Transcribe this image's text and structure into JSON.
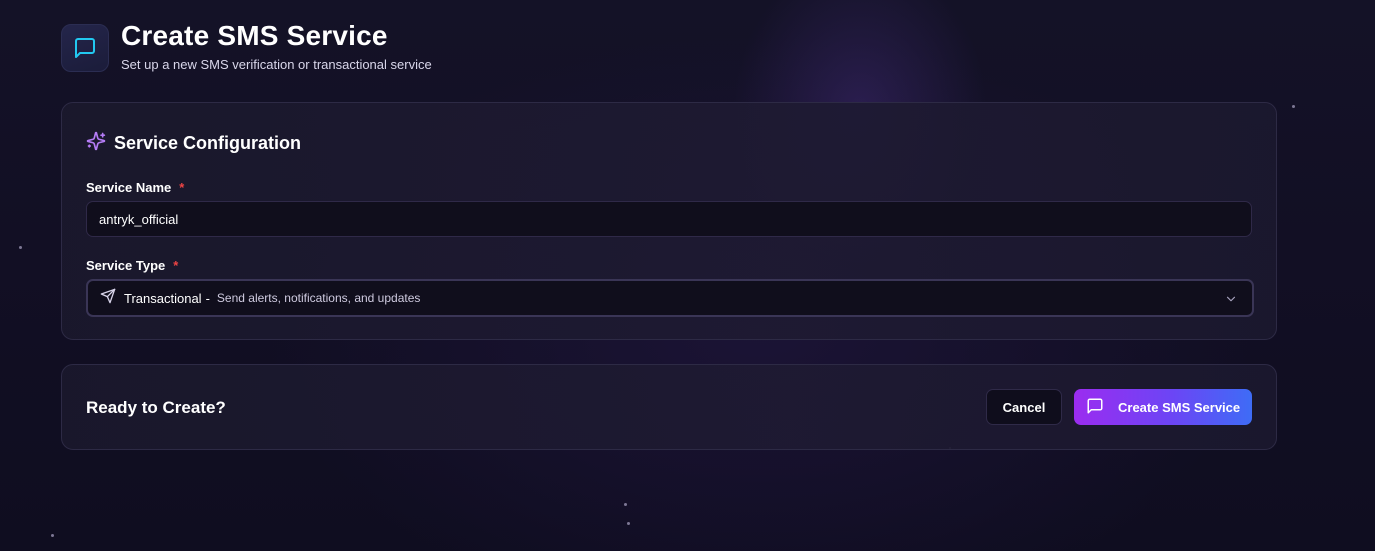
{
  "header": {
    "title": "Create SMS Service",
    "subtitle": "Set up a new SMS verification or transactional service",
    "icon": "message-square-icon"
  },
  "config": {
    "section_title": "Service Configuration",
    "section_icon": "sparkles-icon",
    "service_name": {
      "label": "Service Name",
      "required_marker": "*",
      "value": "antryk_official"
    },
    "service_type": {
      "label": "Service Type",
      "required_marker": "*",
      "icon": "send-icon",
      "selected": "Transactional",
      "separator": "-",
      "description": "Send alerts, notifications, and updates"
    }
  },
  "ready": {
    "title": "Ready to Create?",
    "cancel_label": "Cancel",
    "create_label": "Create SMS Service",
    "create_icon": "message-square-icon"
  },
  "colors": {
    "accent_purple": "#9b2cf0",
    "accent_blue": "#3e6cf6",
    "required_red": "#ef4444",
    "header_icon_cyan": "#22c8f0"
  }
}
